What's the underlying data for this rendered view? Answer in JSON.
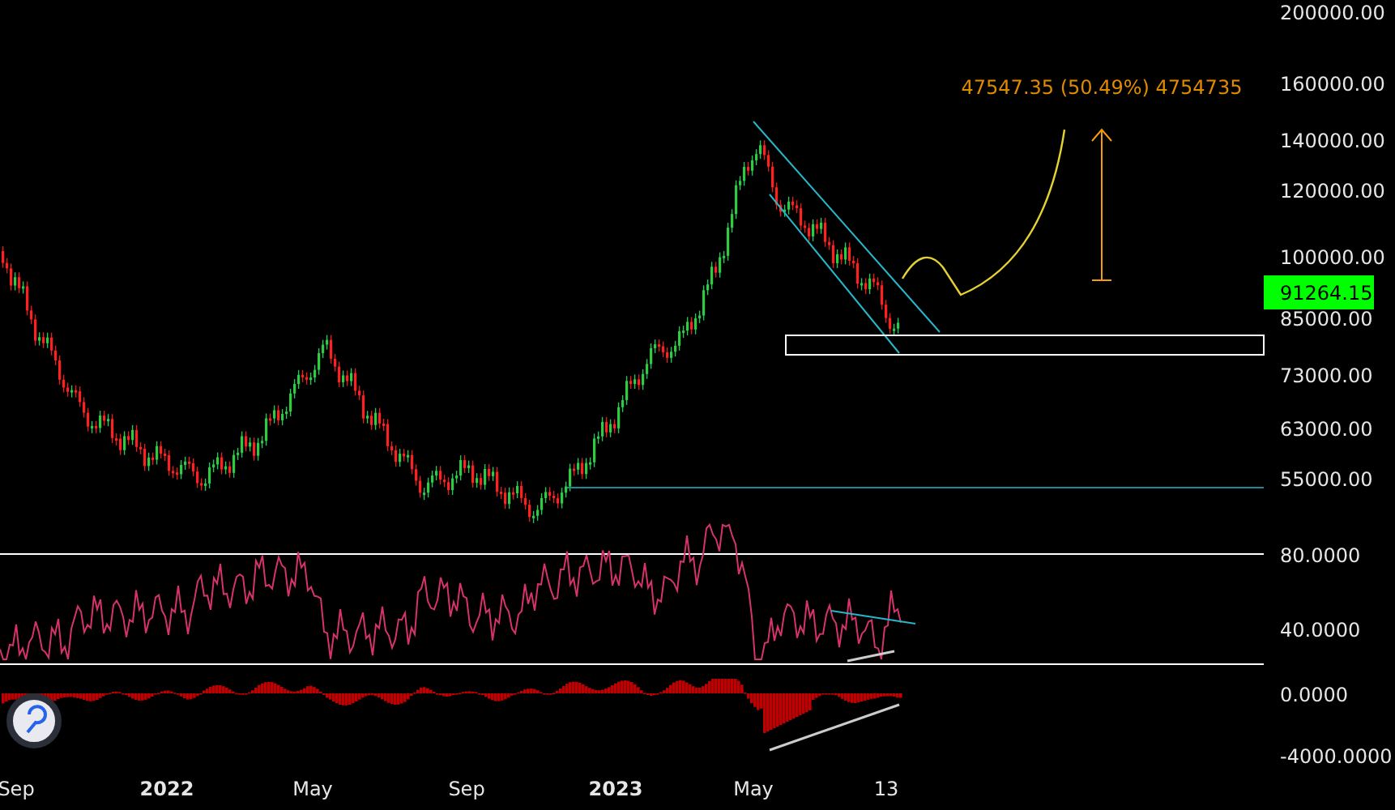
{
  "price_axis": {
    "labels": [
      "200000.00",
      "160000.00",
      "140000.00",
      "120000.00",
      "100000.00",
      "85000.00",
      "73000.00",
      "63000.00",
      "55000.00"
    ]
  },
  "last_price": {
    "label": "91264.15",
    "color": "#00ff00"
  },
  "measure_label": "47547.35 (50.49%) 4754735",
  "rsi_axis": {
    "labels": [
      "80.0000",
      "40.0000"
    ]
  },
  "macd_axis": {
    "labels": [
      "0.0000",
      "-4000.0000"
    ]
  },
  "time_axis": {
    "labels": [
      {
        "text": "Sep",
        "kind": "month"
      },
      {
        "text": "2022",
        "kind": "year"
      },
      {
        "text": "May",
        "kind": "month"
      },
      {
        "text": "Sep",
        "kind": "month"
      },
      {
        "text": "2023",
        "kind": "year"
      },
      {
        "text": "May",
        "kind": "month"
      },
      {
        "text": "13",
        "kind": "month"
      }
    ]
  }
}
